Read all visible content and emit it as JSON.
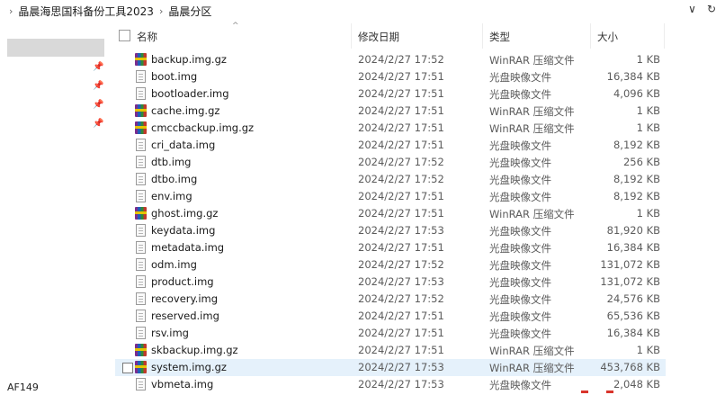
{
  "breadcrumb": {
    "items": [
      "晶晨海思国科备份工具2023",
      "晶晨分区"
    ],
    "separator": "›"
  },
  "toolbar": {
    "dropdown_glyph": "∨",
    "refresh_glyph": "↻"
  },
  "status": {
    "text": "AF149"
  },
  "columns": {
    "name": "名称",
    "date": "修改日期",
    "type": "类型",
    "size": "大小"
  },
  "files": [
    {
      "name": "backup.img.gz",
      "date": "2024/2/27 17:52",
      "type": "WinRAR 压缩文件",
      "size": "1 KB",
      "icon": "winrar-icon"
    },
    {
      "name": "boot.img",
      "date": "2024/2/27 17:51",
      "type": "光盘映像文件",
      "size": "16,384 KB",
      "icon": "disc-image-file-icon"
    },
    {
      "name": "bootloader.img",
      "date": "2024/2/27 17:51",
      "type": "光盘映像文件",
      "size": "4,096 KB",
      "icon": "disc-image-file-icon"
    },
    {
      "name": "cache.img.gz",
      "date": "2024/2/27 17:51",
      "type": "WinRAR 压缩文件",
      "size": "1 KB",
      "icon": "winrar-icon"
    },
    {
      "name": "cmccbackup.img.gz",
      "date": "2024/2/27 17:51",
      "type": "WinRAR 压缩文件",
      "size": "1 KB",
      "icon": "winrar-icon"
    },
    {
      "name": "cri_data.img",
      "date": "2024/2/27 17:51",
      "type": "光盘映像文件",
      "size": "8,192 KB",
      "icon": "disc-image-file-icon"
    },
    {
      "name": "dtb.img",
      "date": "2024/2/27 17:52",
      "type": "光盘映像文件",
      "size": "256 KB",
      "icon": "disc-image-file-icon"
    },
    {
      "name": "dtbo.img",
      "date": "2024/2/27 17:52",
      "type": "光盘映像文件",
      "size": "8,192 KB",
      "icon": "disc-image-file-icon"
    },
    {
      "name": "env.img",
      "date": "2024/2/27 17:51",
      "type": "光盘映像文件",
      "size": "8,192 KB",
      "icon": "disc-image-file-icon"
    },
    {
      "name": "ghost.img.gz",
      "date": "2024/2/27 17:51",
      "type": "WinRAR 压缩文件",
      "size": "1 KB",
      "icon": "winrar-icon"
    },
    {
      "name": "keydata.img",
      "date": "2024/2/27 17:53",
      "type": "光盘映像文件",
      "size": "81,920 KB",
      "icon": "disc-image-file-icon"
    },
    {
      "name": "metadata.img",
      "date": "2024/2/27 17:51",
      "type": "光盘映像文件",
      "size": "16,384 KB",
      "icon": "disc-image-file-icon"
    },
    {
      "name": "odm.img",
      "date": "2024/2/27 17:52",
      "type": "光盘映像文件",
      "size": "131,072 KB",
      "icon": "disc-image-file-icon"
    },
    {
      "name": "product.img",
      "date": "2024/2/27 17:53",
      "type": "光盘映像文件",
      "size": "131,072 KB",
      "icon": "disc-image-file-icon"
    },
    {
      "name": "recovery.img",
      "date": "2024/2/27 17:52",
      "type": "光盘映像文件",
      "size": "24,576 KB",
      "icon": "disc-image-file-icon"
    },
    {
      "name": "reserved.img",
      "date": "2024/2/27 17:51",
      "type": "光盘映像文件",
      "size": "65,536 KB",
      "icon": "disc-image-file-icon"
    },
    {
      "name": "rsv.img",
      "date": "2024/2/27 17:51",
      "type": "光盘映像文件",
      "size": "16,384 KB",
      "icon": "disc-image-file-icon"
    },
    {
      "name": "skbackup.img.gz",
      "date": "2024/2/27 17:51",
      "type": "WinRAR 压缩文件",
      "size": "1 KB",
      "icon": "winrar-icon"
    },
    {
      "name": "system.img.gz",
      "date": "2024/2/27 17:53",
      "type": "WinRAR 压缩文件",
      "size": "453,768 KB",
      "icon": "winrar-icon",
      "hovered": true
    },
    {
      "name": "vbmeta.img",
      "date": "2024/2/27 17:53",
      "type": "光盘映像文件",
      "size": "2,048 KB",
      "icon": "disc-image-file-icon"
    }
  ]
}
